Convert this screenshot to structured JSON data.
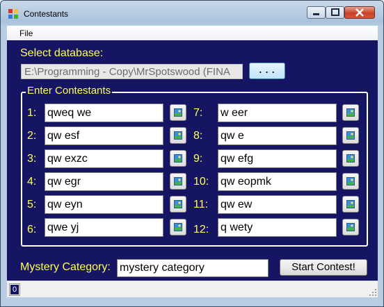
{
  "window": {
    "title": "Contestants",
    "app_icon": "app-form-icon",
    "controls": [
      "minimize-icon",
      "maximize-icon",
      "close-icon"
    ]
  },
  "menu": {
    "file": "File"
  },
  "database": {
    "label": "Select database:",
    "path": "E:\\Programming - Copy\\MrSpotswood (FINA",
    "browse_label": ". . ."
  },
  "contestants": {
    "legend": "Enter Contestants",
    "left": [
      {
        "num": "1:",
        "name": "qweq we"
      },
      {
        "num": "2:",
        "name": "qw esf"
      },
      {
        "num": "3:",
        "name": "qw exzc"
      },
      {
        "num": "4:",
        "name": "qw egr"
      },
      {
        "num": "5:",
        "name": "qw eyn"
      },
      {
        "num": "6:",
        "name": "qwe yj"
      }
    ],
    "right": [
      {
        "num": "7:",
        "name": "w eer"
      },
      {
        "num": "8:",
        "name": "qw e"
      },
      {
        "num": "9:",
        "name": "qw efg"
      },
      {
        "num": "10:",
        "name": "qw eopmk"
      },
      {
        "num": "11:",
        "name": "qw ew"
      },
      {
        "num": "12:",
        "name": "q wety"
      }
    ],
    "picture_icon": "image-icon"
  },
  "mystery": {
    "label": "Mystery Category:",
    "value": "mystery category"
  },
  "start_label": "Start Contest!",
  "status": {
    "value": "0"
  },
  "colors": {
    "background": "#151563",
    "label": "#ffff55",
    "border": "#ffffff"
  }
}
